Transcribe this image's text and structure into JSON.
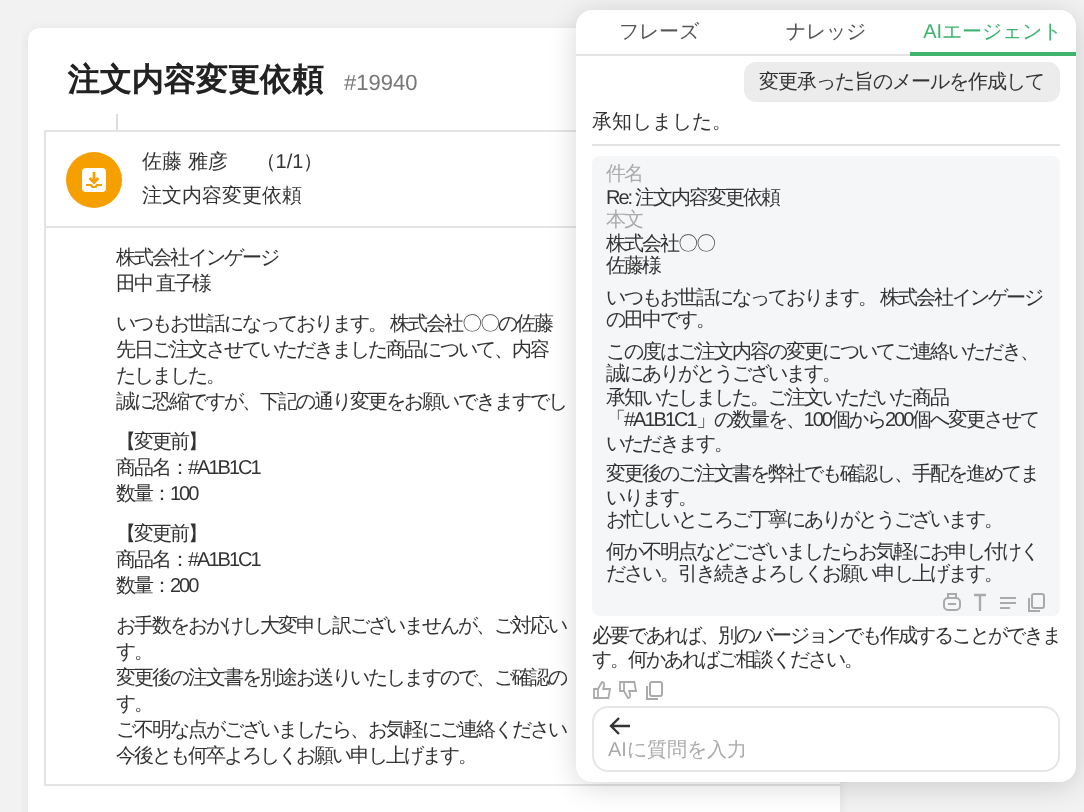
{
  "ticket": {
    "title": "注文内容変更依頼",
    "number": "#19940"
  },
  "message": {
    "sender": "佐藤 雅彦",
    "count": "（1/1）",
    "subject": "注文内容変更依頼",
    "body": [
      [
        "株式会社インゲージ",
        "田中 直子様"
      ],
      [
        "いつもお世話になっております。 株式会社〇〇の佐藤",
        "先日ご注文させていただきました商品について、内容",
        "たしました。",
        "誠に恐縮ですが、下記の通り変更をお願いできますでし"
      ],
      [
        "【変更前】",
        "商品名：#A1B1C1",
        "数量：100"
      ],
      [
        "【変更前】",
        "商品名：#A1B1C1",
        "数量：200"
      ],
      [
        "お手数をおかけし大変申し訳ございませんが、ご対応い",
        "す。",
        "変更後の注文書を別途お送りいたしますので、ご確認の",
        "す。",
        "ご不明な点がございましたら、お気軽にご連絡ください",
        "今後とも何卒よろしくお願い申し上げます。"
      ]
    ]
  },
  "assistant": {
    "tabs": [
      {
        "label": "フレーズ",
        "selected": false
      },
      {
        "label": "ナレッジ",
        "selected": false
      },
      {
        "label": "AIエージェント",
        "selected": true
      }
    ],
    "user_message": "変更承った旨のメールを作成して",
    "reply": "承知しました。",
    "draft": {
      "subject_label": "件名",
      "subject": "Re: 注文内容変更依頼",
      "body_label": "本文",
      "body": [
        [
          "株式会社〇〇",
          "佐藤様"
        ],
        [
          "いつもお世話になっております。 株式会社インゲージの田中です。"
        ],
        [
          "この度はご注文内容の変更についてご連絡いただき、誠にありがとうございます。",
          "承知いたしました。ご注文いただいた商品「#A1B1C1」の数量を、100個から200個へ変更させていただきます。"
        ],
        [
          "変更後のご注文書を弊社でも確認し、手配を進めてまいります。",
          "お忙しいところご丁寧にありがとうございます。"
        ],
        [
          "何か不明点などございましたらお気軽にお申し付けください。引き続きよろしくお願い申し上げます。"
        ]
      ]
    },
    "follow_up": "必要であれば、別のバージョンでも作成することができます。何かあればご相談ください。",
    "input": {
      "placeholder": "AIに質問を入力"
    }
  }
}
